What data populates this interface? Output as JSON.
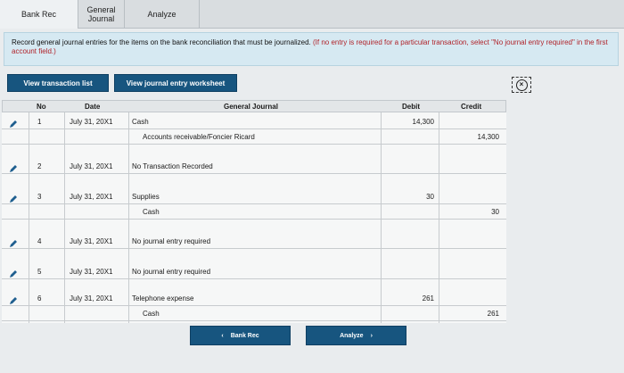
{
  "tabs": [
    {
      "label": "Bank Rec"
    },
    {
      "label": "General Journal"
    },
    {
      "label": "Analyze"
    }
  ],
  "instruction": {
    "text": "Record general journal entries for the items on the bank reconciliation that must be journalized.",
    "hint": "(If no entry is required for a particular transaction, select \"No journal entry required\" in the first account field.)"
  },
  "buttons": {
    "view_transactions": "View transaction list",
    "view_worksheet": "View journal entry worksheet"
  },
  "close_icon": "close-circle-icon",
  "table": {
    "headers": {
      "no": "No",
      "date": "Date",
      "journal": "General Journal",
      "debit": "Debit",
      "credit": "Credit"
    },
    "entries": [
      {
        "no": "1",
        "date": "July 31, 20X1",
        "lines": [
          {
            "account": "Cash",
            "debit": "14,300",
            "credit": ""
          },
          {
            "account": "Accounts receivable/Foncier Ricard",
            "debit": "",
            "credit": "14,300"
          }
        ]
      },
      {
        "no": "2",
        "date": "July 31, 20X1",
        "lines": [
          {
            "account": "No Transaction Recorded",
            "debit": "",
            "credit": ""
          }
        ]
      },
      {
        "no": "3",
        "date": "July 31, 20X1",
        "lines": [
          {
            "account": "Supplies",
            "debit": "30",
            "credit": ""
          },
          {
            "account": "Cash",
            "debit": "",
            "credit": "30"
          }
        ]
      },
      {
        "no": "4",
        "date": "July 31, 20X1",
        "lines": [
          {
            "account": "No journal entry required",
            "debit": "",
            "credit": ""
          }
        ]
      },
      {
        "no": "5",
        "date": "July 31, 20X1",
        "lines": [
          {
            "account": "No journal entry required",
            "debit": "",
            "credit": ""
          }
        ]
      },
      {
        "no": "6",
        "date": "July 31, 20X1",
        "lines": [
          {
            "account": "Telephone expense",
            "debit": "261",
            "credit": ""
          },
          {
            "account": "Cash",
            "debit": "",
            "credit": "261"
          }
        ]
      }
    ]
  },
  "nav": {
    "prev": "Bank Rec",
    "next": "Analyze",
    "prev_icon": "chevron-left-icon",
    "next_icon": "chevron-right-icon"
  },
  "colors": {
    "accent": "#17557f",
    "hint": "#b0232a",
    "instruction_bg": "#d6e9f2"
  }
}
